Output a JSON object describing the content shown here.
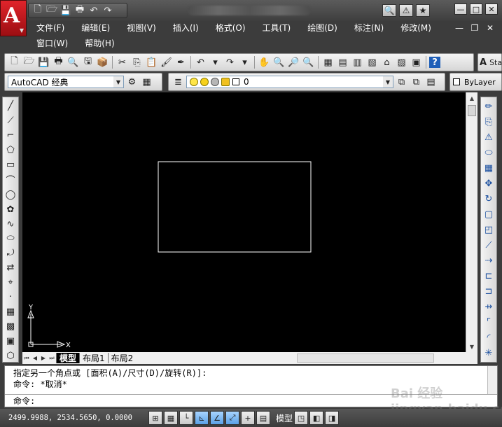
{
  "app": {
    "logo_letter": "A",
    "logo_caret": "▼"
  },
  "quick_access": {
    "icons": [
      "new-icon",
      "open-icon",
      "save-icon",
      "print-icon",
      "undo-icon",
      "redo-icon"
    ],
    "glyphs": [
      "🗋",
      "🗁",
      "💾",
      "🖶",
      "↶",
      "↷"
    ]
  },
  "help_group": {
    "search": "🔍",
    "search_caret": "▾",
    "favorites": "★",
    "user": "⚠"
  },
  "window_controls": {
    "minimize": "—",
    "maximize": "□",
    "close": "✕"
  },
  "doc_controls": {
    "minimize": "—",
    "restore": "❐",
    "close": "✕"
  },
  "menu": {
    "row1": [
      "文件(F)",
      "编辑(E)",
      "视图(V)",
      "插入(I)",
      "格式(O)",
      "工具(T)",
      "绘图(D)",
      "标注(N)",
      "修改(M)"
    ],
    "row2": [
      "窗口(W)",
      "帮助(H)"
    ]
  },
  "standard_toolbar": {
    "glyphs": [
      "🗋",
      "🗁",
      "💾",
      "🖶",
      "🔍",
      "🖫",
      "📦",
      "✂",
      "⎘",
      "📋",
      "🖌",
      "✒",
      "↶",
      "▾",
      "↷",
      "▾",
      "✋",
      "🔍",
      "🔎",
      "🔍",
      "▦",
      "▤",
      "▥",
      "▧",
      "⌂",
      "▨",
      "▣",
      "?"
    ]
  },
  "style_toolbar": {
    "label": "Sta",
    "icon": "A"
  },
  "workspace": {
    "value": "AutoCAD 经典",
    "caret": "▼",
    "gear": "⚙",
    "grid": "▦"
  },
  "layer": {
    "value": "0",
    "caret": "▼",
    "manager": "≣",
    "icon_a": "⧉",
    "icon_b": "⧉",
    "icon_c": "▤"
  },
  "properties": {
    "value": "ByLayer"
  },
  "drawing": {
    "ucs_x": "X",
    "ucs_y": "Y",
    "rect_color": "#ffffff",
    "background": "#000000"
  },
  "layout_tabs": {
    "nav": [
      "⏮",
      "◀",
      "▶",
      "⏭"
    ],
    "tabs": [
      "模型",
      "布局1",
      "布局2"
    ]
  },
  "left_tools": [
    "╱",
    "⟋",
    "⌐",
    "⬠",
    "▭",
    "⌒",
    "◯",
    "✿",
    "∿",
    "⬭",
    "⤾",
    "⇄",
    "⌖",
    "·",
    "▦",
    "▩",
    "▣",
    "⬡"
  ],
  "right_tools": [
    "✏",
    "⎘",
    "⚠",
    "⬭",
    "▦",
    "✥",
    "↻",
    "▢",
    "◰",
    "⟋",
    "⇢",
    "⊏",
    "⊐",
    "⇸",
    "⌜",
    "◜",
    "✳"
  ],
  "command": {
    "history": [
      "指定另一个角点或 [面积(A)/尺寸(D)/旋转(R)]:",
      "命令: *取消*"
    ],
    "prompt": "命令:"
  },
  "watermark": "Bai 经验 jingyan.baidu.com",
  "status": {
    "coords": "2499.9988, 2534.5650, 0.0000",
    "toggles": [
      "⊞",
      "▦",
      "└",
      "⊾",
      "∠",
      "⤢",
      "+",
      "▤"
    ],
    "model": "模型",
    "extra": [
      "◳",
      "◧",
      "◨"
    ]
  },
  "colors": {
    "title_bg": "#4a4a4a",
    "canvas_bg": "#000000",
    "logo_red": "#c8161d"
  }
}
